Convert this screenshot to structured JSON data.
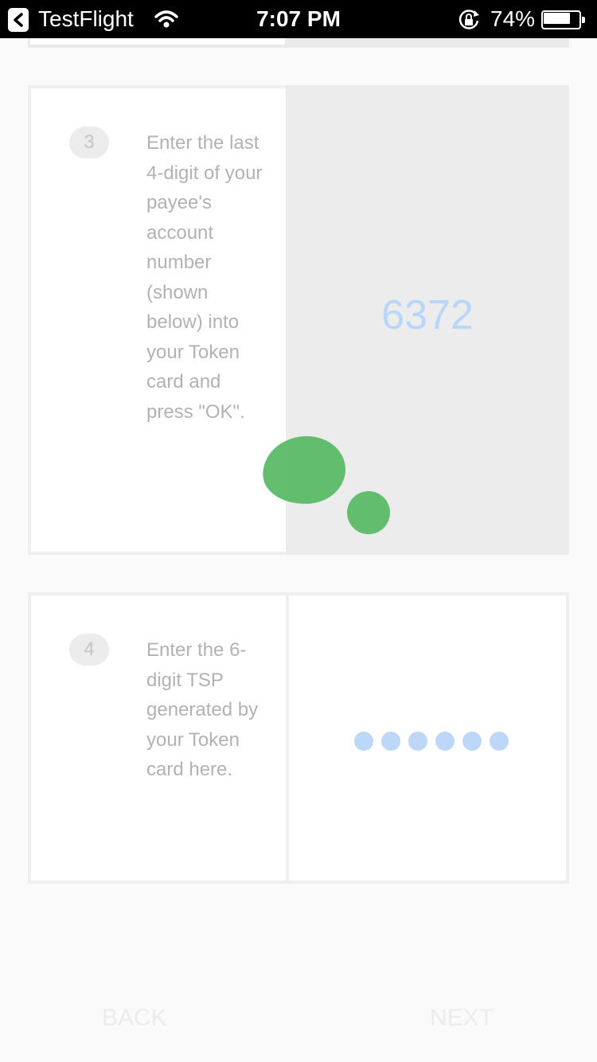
{
  "status_bar": {
    "app_name": "TestFlight",
    "time": "7:07 PM",
    "battery_percent": "74%",
    "battery_level": 0.74,
    "icons": [
      "back-arrow-icon",
      "wifi-icon",
      "orientation-lock-icon",
      "battery-icon"
    ]
  },
  "step3": {
    "number": "3",
    "instruction": "Enter the last 4-digit of your payee's account number (shown below) into your Token card and press \"OK\".",
    "code": "6372"
  },
  "step4": {
    "number": "4",
    "instruction": "Enter the 6-digit TSP generated by your Token card here.",
    "pin_length": 6
  },
  "nav": {
    "back_label": "BACK",
    "next_label": "NEXT"
  },
  "colors": {
    "status_bar_bg": "#000000",
    "accent_blue": "#b8d6fb",
    "touch_indicator": "#5bbb68",
    "muted_text": "#b2b2b2"
  }
}
